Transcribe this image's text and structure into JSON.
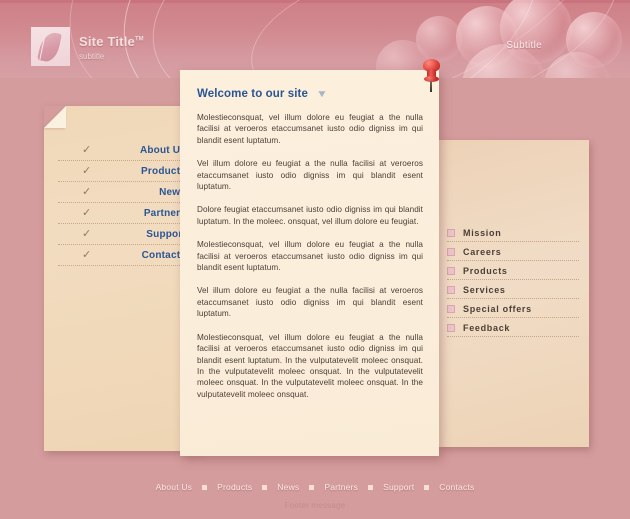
{
  "header": {
    "site_title": "Site Title",
    "trademark": "TM",
    "site_subtitle": "subtitle",
    "banner_subtitle": "Subtitle",
    "logo_icon": "leaf-logo-icon"
  },
  "left_nav": {
    "check_icon": "check-icon",
    "items": [
      {
        "label": "About Us"
      },
      {
        "label": "Products"
      },
      {
        "label": "News"
      },
      {
        "label": "Partners"
      },
      {
        "label": "Support"
      },
      {
        "label": "Contacts"
      }
    ]
  },
  "main": {
    "heading": "Welcome to our site",
    "heading_glyph": "leaf-chevron-icon",
    "pin_icon": "push-pin-icon",
    "paragraphs": [
      "Molestieconsquat, vel illum dolore eu feugiat a the nulla facilisi at veroeros etaccumsanet iusto odio digniss im qui blandit esent luptatum.",
      "Vel illum dolore eu feugiat a the nulla facilisi at veroeros etaccumsanet iusto odio digniss im qui blandit esent luptatum.",
      "Dolore feugiat   etaccumsanet iusto odio digniss im qui blandit luptatum. In the moleec. onsquat, vel illum dolore eu feugiat.",
      "Molestieconsquat, vel illum dolore eu feugiat a the nulla facilisi at veroeros etaccumsanet iusto odio digniss im qui blandit esent luptatum.",
      "Vel illum dolore eu feugiat a the nulla facilisi at veroeros etaccumsanet iusto odio digniss im qui blandit esent luptatum.",
      "Molestieconsquat, vel illum dolore eu feugiat a the nulla facilisi at veroeros etaccumsanet iusto odio digniss im qui blandit esent luptatum. In the vulputatevelit moleec onsquat. In the vulputatevelit moleec onsquat. In the vulputatevelit moleec onsquat. In the vulputatevelit moleec onsquat. In the vulputatevelit moleec onsquat."
    ]
  },
  "sidebar": {
    "bullet_icon": "square-bullet-icon",
    "items": [
      {
        "label": "Mission"
      },
      {
        "label": "Careers"
      },
      {
        "label": "Products"
      },
      {
        "label": "Services"
      },
      {
        "label": "Special offers"
      },
      {
        "label": "Feedback"
      }
    ]
  },
  "footer": {
    "items": [
      {
        "label": "About Us"
      },
      {
        "label": "Products"
      },
      {
        "label": "News"
      },
      {
        "label": "Partners"
      },
      {
        "label": "Support"
      },
      {
        "label": "Contacts"
      }
    ],
    "message": "Footer message"
  },
  "colors": {
    "background": "#d49c9c",
    "header_top": "#cf7f87",
    "panel_cream": "#fcefdc",
    "panel_tan": "#f0d7b8",
    "link_blue": "#2a5694",
    "pin_red": "#e0453e",
    "sidebar_text": "#4d4036"
  }
}
